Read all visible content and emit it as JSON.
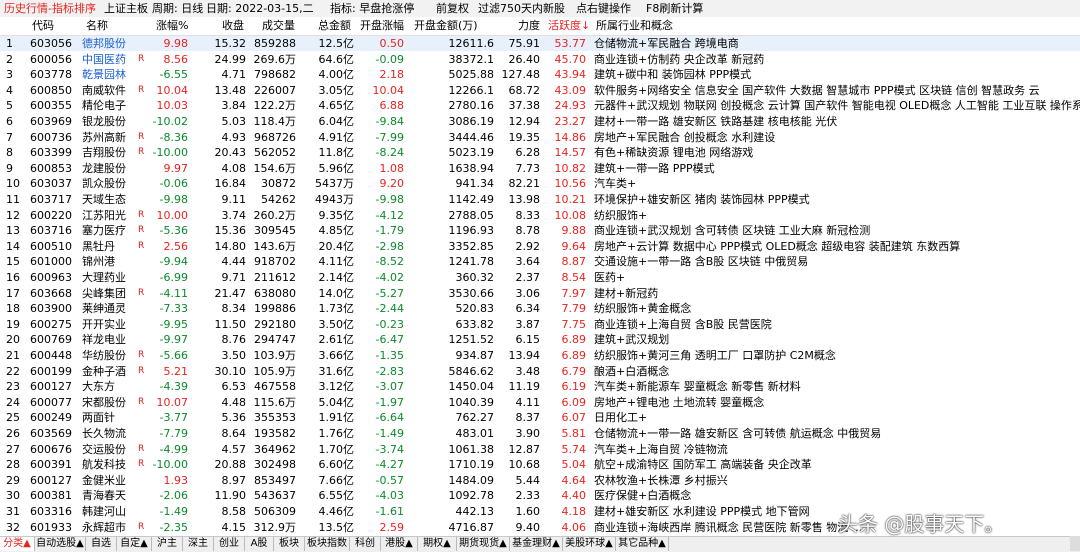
{
  "titlebar": {
    "left": "历史行情-指标排序",
    "market": "上证主板",
    "period": "周期: 日线",
    "date": "日期: 2022-03-15,二",
    "indicator": "指标: 早盘抢涨停",
    "adjust": "前复权",
    "filter": "过滤750天内新股",
    "hint": "点右键操作",
    "refresh": "F8刷新计算"
  },
  "headers": {
    "code": "代码",
    "name": "名称",
    "pct": "涨幅%",
    "close": "收盘",
    "vol": "成交量",
    "amount": "总金额",
    "open_pct": "开盘涨幅",
    "open_amt": "开盘金额(万)",
    "strength": "力度",
    "active": "活跃度↓",
    "industry": "所属行业和概念"
  },
  "rows": [
    {
      "n": "1",
      "code": "603056",
      "name": "德邦股份",
      "r": "",
      "pct": "9.98",
      "close": "15.32",
      "vol": "859288",
      "amt": "12.5亿",
      "open": "0.50",
      "oamt": "12611.6",
      "str": "75.91",
      "act": "53.77",
      "ind": "仓储物流+军民融合 跨境电商"
    },
    {
      "n": "2",
      "code": "600056",
      "name": "中国医药",
      "r": "R",
      "pct": "8.56",
      "close": "24.99",
      "vol": "269.6万",
      "amt": "64.6亿",
      "open": "-0.09",
      "oamt": "38372.1",
      "str": "26.40",
      "act": "45.70",
      "ind": "商业连锁+仿制药 央企改革 新冠药"
    },
    {
      "n": "3",
      "code": "603778",
      "name": "乾景园林",
      "r": "",
      "pct": "-6.55",
      "close": "4.71",
      "vol": "798682",
      "amt": "4.00亿",
      "open": "2.18",
      "oamt": "5025.88",
      "str": "127.48",
      "act": "43.94",
      "ind": "建筑+碳中和 装饰园林 PPP模式"
    },
    {
      "n": "4",
      "code": "600850",
      "name": "南威软件",
      "r": "R",
      "pct": "10.04",
      "close": "13.48",
      "vol": "226007",
      "amt": "3.05亿",
      "open": "10.04",
      "oamt": "12266.1",
      "str": "68.72",
      "act": "43.09",
      "ind": "软件服务+网络安全 信息安全 国产软件 大数据 智慧城市 PPP模式 区块链 信创 智慧政务 云"
    },
    {
      "n": "5",
      "code": "600355",
      "name": "精伦电子",
      "r": "",
      "pct": "10.03",
      "close": "3.84",
      "vol": "122.2万",
      "amt": "4.65亿",
      "open": "6.88",
      "oamt": "2780.16",
      "str": "37.38",
      "act": "24.93",
      "ind": "元器件+武汉规划 物联网 创投概念 云计算 国产软件 智能电视 OLED概念 人工智能 工业互联 操作系"
    },
    {
      "n": "6",
      "code": "603969",
      "name": "银龙股份",
      "r": "",
      "pct": "-10.02",
      "close": "5.03",
      "vol": "118.4万",
      "amt": "6.04亿",
      "open": "-9.84",
      "oamt": "3086.19",
      "str": "12.94",
      "act": "23.27",
      "ind": "建材+一带一路 雄安新区 铁路基建 核电核能 光伏"
    },
    {
      "n": "7",
      "code": "600736",
      "name": "苏州高新",
      "r": "R",
      "pct": "-8.36",
      "close": "4.93",
      "vol": "968726",
      "amt": "4.91亿",
      "open": "-7.99",
      "oamt": "3444.46",
      "str": "19.35",
      "act": "14.86",
      "ind": "房地产+军民融合 创投概念 水利建设"
    },
    {
      "n": "8",
      "code": "603399",
      "name": "吉翔股份",
      "r": "R",
      "pct": "-10.00",
      "close": "20.43",
      "vol": "562052",
      "amt": "11.8亿",
      "open": "-8.24",
      "oamt": "5023.19",
      "str": "6.28",
      "act": "14.57",
      "ind": "有色+稀缺资源 锂电池 网络游戏"
    },
    {
      "n": "9",
      "code": "600853",
      "name": "龙建股份",
      "r": "",
      "pct": "9.97",
      "close": "4.08",
      "vol": "154.6万",
      "amt": "5.96亿",
      "open": "1.08",
      "oamt": "1638.94",
      "str": "7.73",
      "act": "10.82",
      "ind": "建筑+一带一路 PPP模式"
    },
    {
      "n": "10",
      "code": "603037",
      "name": "凯众股份",
      "r": "",
      "pct": "-0.06",
      "close": "16.84",
      "vol": "30872",
      "amt": "5437万",
      "open": "9.20",
      "oamt": "941.34",
      "str": "82.21",
      "act": "10.56",
      "ind": "汽车类+"
    },
    {
      "n": "11",
      "code": "603717",
      "name": "天域生态",
      "r": "",
      "pct": "-9.98",
      "close": "9.11",
      "vol": "54262",
      "amt": "4943万",
      "open": "-9.98",
      "oamt": "1142.49",
      "str": "13.98",
      "act": "10.21",
      "ind": "环境保护+雄安新区 猪肉 装饰园林 PPP模式"
    },
    {
      "n": "12",
      "code": "600220",
      "name": "江苏阳光",
      "r": "R",
      "pct": "10.00",
      "close": "3.74",
      "vol": "260.2万",
      "amt": "9.35亿",
      "open": "-4.12",
      "oamt": "2788.05",
      "str": "8.33",
      "act": "10.08",
      "ind": "纺织服饰+"
    },
    {
      "n": "13",
      "code": "603716",
      "name": "塞力医疗",
      "r": "R",
      "pct": "-5.36",
      "close": "15.36",
      "vol": "309545",
      "amt": "4.85亿",
      "open": "-1.79",
      "oamt": "1196.93",
      "str": "8.78",
      "act": "9.88",
      "ind": "商业连锁+武汉规划 含可转债 区块链 工业大麻 新冠检测"
    },
    {
      "n": "14",
      "code": "600510",
      "name": "黑牡丹",
      "r": "R",
      "pct": "2.56",
      "close": "14.80",
      "vol": "143.6万",
      "amt": "20.4亿",
      "open": "-2.98",
      "oamt": "3352.85",
      "str": "2.92",
      "act": "9.64",
      "ind": "房地产+云计算 数据中心 PPP模式 OLED概念 超级电容 装配建筑 东数西算"
    },
    {
      "n": "15",
      "code": "601000",
      "name": "锦州港",
      "r": "",
      "pct": "-9.94",
      "close": "4.44",
      "vol": "918702",
      "amt": "4.11亿",
      "open": "-8.52",
      "oamt": "1241.78",
      "str": "3.64",
      "act": "8.87",
      "ind": "交通设施+一带一路 含B股 区块链 中俄贸易"
    },
    {
      "n": "16",
      "code": "600963",
      "name": "大理药业",
      "r": "",
      "pct": "-6.99",
      "close": "9.71",
      "vol": "211612",
      "amt": "2.14亿",
      "open": "-4.02",
      "oamt": "360.32",
      "str": "2.37",
      "act": "8.54",
      "ind": "医药+"
    },
    {
      "n": "17",
      "code": "603668",
      "name": "尖峰集团",
      "r": "R",
      "pct": "-4.11",
      "close": "21.47",
      "vol": "638080",
      "amt": "14.0亿",
      "open": "-5.27",
      "oamt": "3530.66",
      "str": "3.06",
      "act": "7.97",
      "ind": "建材+新冠药"
    },
    {
      "n": "18",
      "code": "603900",
      "name": "莱绅通灵",
      "r": "",
      "pct": "-7.33",
      "close": "8.34",
      "vol": "199886",
      "amt": "1.73亿",
      "open": "-2.44",
      "oamt": "520.83",
      "str": "6.34",
      "act": "7.79",
      "ind": "纺织服饰+黄金概念"
    },
    {
      "n": "19",
      "code": "600275",
      "name": "开开实业",
      "r": "",
      "pct": "-9.95",
      "close": "11.50",
      "vol": "292180",
      "amt": "3.50亿",
      "open": "-0.23",
      "oamt": "633.82",
      "str": "3.87",
      "act": "7.75",
      "ind": "商业连锁+上海自贸 含B股 民营医院"
    },
    {
      "n": "20",
      "code": "600769",
      "name": "祥龙电业",
      "r": "",
      "pct": "-9.97",
      "close": "8.76",
      "vol": "294747",
      "amt": "2.61亿",
      "open": "-6.47",
      "oamt": "1251.52",
      "str": "6.15",
      "act": "6.89",
      "ind": "建筑+武汉规划"
    },
    {
      "n": "21",
      "code": "600448",
      "name": "华纺股份",
      "r": "R",
      "pct": "-5.66",
      "close": "3.50",
      "vol": "103.9万",
      "amt": "3.66亿",
      "open": "-1.35",
      "oamt": "934.87",
      "str": "13.94",
      "act": "6.89",
      "ind": "纺织服饰+黄河三角 透明工厂 口罩防护 C2M概念"
    },
    {
      "n": "22",
      "code": "600199",
      "name": "金种子酒",
      "r": "R",
      "pct": "5.21",
      "close": "30.10",
      "vol": "105.9万",
      "amt": "31.6亿",
      "open": "-2.83",
      "oamt": "5846.62",
      "str": "3.48",
      "act": "6.79",
      "ind": "酿酒+白酒概念"
    },
    {
      "n": "23",
      "code": "600127",
      "name": "大东方",
      "r": "",
      "pct": "-4.39",
      "close": "6.53",
      "vol": "467558",
      "amt": "3.12亿",
      "open": "-3.07",
      "oamt": "1450.04",
      "str": "11.19",
      "act": "6.19",
      "ind": "汽车类+新能源车 婴童概念 新零售 新材料"
    },
    {
      "n": "24",
      "code": "600077",
      "name": "宋都股份",
      "r": "R",
      "pct": "10.07",
      "close": "4.48",
      "vol": "115.6万",
      "amt": "5.04亿",
      "open": "-1.97",
      "oamt": "1040.39",
      "str": "4.11",
      "act": "6.09",
      "ind": "房地产+锂电池 土地流转 婴童概念"
    },
    {
      "n": "25",
      "code": "600249",
      "name": "两面针",
      "r": "",
      "pct": "-3.77",
      "close": "5.36",
      "vol": "355353",
      "amt": "1.91亿",
      "open": "-6.64",
      "oamt": "762.27",
      "str": "8.37",
      "act": "6.07",
      "ind": "日用化工+"
    },
    {
      "n": "26",
      "code": "603569",
      "name": "长久物流",
      "r": "",
      "pct": "-7.79",
      "close": "8.64",
      "vol": "193582",
      "amt": "1.76亿",
      "open": "-1.49",
      "oamt": "483.01",
      "str": "3.90",
      "act": "5.81",
      "ind": "仓储物流+一带一路 雄安新区 含可转债 航运概念 中俄贸易"
    },
    {
      "n": "27",
      "code": "600676",
      "name": "交运股份",
      "r": "R",
      "pct": "-4.99",
      "close": "4.57",
      "vol": "364962",
      "amt": "1.70亿",
      "open": "-3.74",
      "oamt": "1061.38",
      "str": "12.87",
      "act": "5.74",
      "ind": "汽车类+上海自贸 冷链物流"
    },
    {
      "n": "28",
      "code": "600391",
      "name": "航发科技",
      "r": "R",
      "pct": "-10.00",
      "close": "20.88",
      "vol": "302498",
      "amt": "6.60亿",
      "open": "-4.27",
      "oamt": "1710.19",
      "str": "10.68",
      "act": "5.04",
      "ind": "航空+成渝特区 国防军工 高端装备 央企改革"
    },
    {
      "n": "29",
      "code": "600127",
      "name": "金健米业",
      "r": "",
      "pct": "1.93",
      "close": "8.97",
      "vol": "853497",
      "amt": "7.66亿",
      "open": "-0.57",
      "oamt": "1484.09",
      "str": "5.44",
      "act": "4.64",
      "ind": "农林牧渔+长株潭 乡村振兴"
    },
    {
      "n": "30",
      "code": "600381",
      "name": "青海春天",
      "r": "",
      "pct": "-2.06",
      "close": "11.90",
      "vol": "543637",
      "amt": "6.55亿",
      "open": "-4.03",
      "oamt": "1092.78",
      "str": "2.33",
      "act": "4.40",
      "ind": "医疗保健+白酒概念"
    },
    {
      "n": "31",
      "code": "603316",
      "name": "韩建河山",
      "r": "",
      "pct": "-1.49",
      "close": "8.58",
      "vol": "506309",
      "amt": "4.46亿",
      "open": "-1.61",
      "oamt": "442.13",
      "str": "1.60",
      "act": "4.18",
      "ind": "建材+雄安新区 水利建设 PPP模式 地下管网"
    },
    {
      "n": "32",
      "code": "601933",
      "name": "永辉超市",
      "r": "R",
      "pct": "-2.35",
      "close": "4.15",
      "vol": "312.9万",
      "amt": "13.5亿",
      "open": "2.59",
      "oamt": "4716.87",
      "str": "9.40",
      "act": "4.06",
      "ind": "商业连锁+海峡西岸 腾讯概念 民营医院 新零售 物流 ..."
    }
  ],
  "tabs": [
    "分类▲",
    "自动选股▲",
    "自选",
    "自定▲",
    "沪主",
    "深主",
    "创业",
    "A股",
    "板块",
    "板块指数",
    "科创",
    "港股▲",
    "期权▲",
    "期货现货▲",
    "基金理财▲",
    "美股环球▲",
    "其它品种▲"
  ],
  "watermark": "头条 @股事天下。",
  "colors": {
    "up": "#e8231f",
    "down": "#0a8a2a",
    "name_link": "#1a5fd0",
    "selection": "#e8f0fb"
  }
}
